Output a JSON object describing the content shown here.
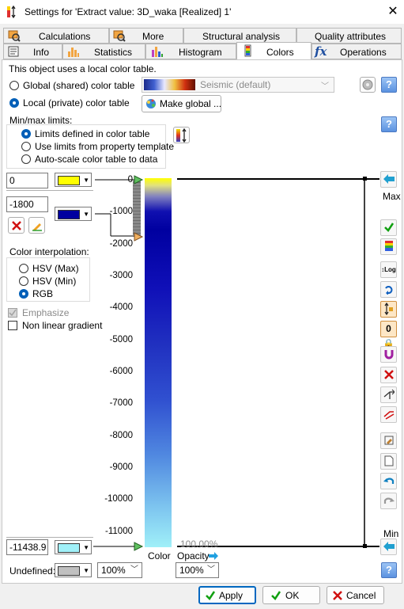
{
  "window": {
    "title": "Settings for 'Extract value: 3D_waka [Realized] 1'",
    "close": "✕"
  },
  "tabs_row1": [
    {
      "label": "Calculations"
    },
    {
      "label": "More"
    },
    {
      "label": "Structural analysis"
    },
    {
      "label": "Quality attributes"
    }
  ],
  "tabs_row2": [
    {
      "label": "Info"
    },
    {
      "label": "Statistics"
    },
    {
      "label": "Histogram"
    },
    {
      "label": "Colors",
      "active": true
    },
    {
      "label": "Operations"
    }
  ],
  "colors": {
    "info": "This object uses a local color table.",
    "global_label": "Global (shared) color table",
    "local_label": "Local (private) color table",
    "colortable_name": "Seismic (default)",
    "make_global": "Make global ...",
    "minmax_title": "Min/max limits:",
    "limits_options": [
      "Limits defined in color table",
      "Use limits from property template",
      "Auto-scale color table to data"
    ],
    "max_value": "0",
    "max_color": "#ffff00",
    "mid_value": "-1800",
    "mid_color": "#0000a0",
    "min_value": "-11438.9",
    "min_color": "#a0f0f8",
    "interp_title": "Color interpolation:",
    "interp_options": [
      "HSV (Max)",
      "HSV (Min)",
      "RGB"
    ],
    "emphasize": "Emphasize",
    "nonlinear": "Non linear gradient",
    "undefined_label": "Undefined:",
    "undefined_color": "#c0c0c0",
    "undefined_opacity": "100%",
    "opacity_value": "100%",
    "color_label": "Color",
    "opacity_label": "Opacity",
    "opacity_pct": "100.00%",
    "max_label": "Max",
    "min_label": "Min"
  },
  "axis": {
    "ticks": [
      "0",
      "-1000",
      "-2000",
      "-3000",
      "-4000",
      "-5000",
      "-6000",
      "-7000",
      "-8000",
      "-9000",
      "-10000",
      "-11000"
    ]
  },
  "buttons": {
    "apply": "Apply",
    "ok": "OK",
    "cancel": "Cancel"
  }
}
